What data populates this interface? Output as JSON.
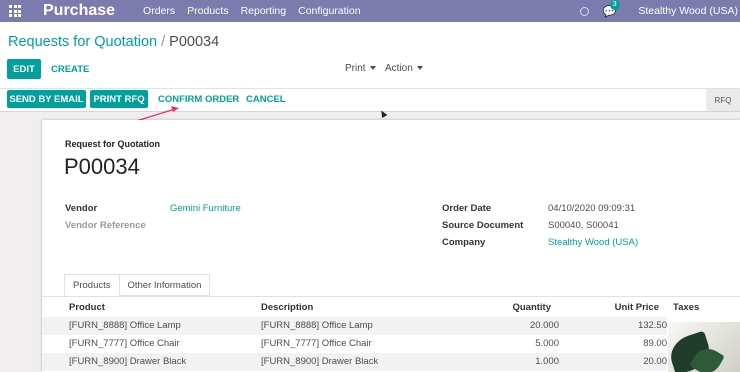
{
  "app": {
    "name": "Purchase"
  },
  "nav": {
    "menu": [
      "Orders",
      "Products",
      "Reporting",
      "Configuration"
    ],
    "chat_badge": "3",
    "company": "Stealthy Wood (USA)"
  },
  "breadcrumb": {
    "parent": "Requests for Quotation",
    "separator": "/",
    "current": "P00034"
  },
  "buttons": {
    "edit": "EDIT",
    "create": "CREATE",
    "print": "Print",
    "action": "Action",
    "send_email": "SEND BY EMAIL",
    "print_rfq": "PRINT RFQ",
    "confirm": "CONFIRM ORDER",
    "cancel": "CANCEL"
  },
  "status": {
    "stage": "RFQ"
  },
  "form": {
    "subtitle": "Request for Quotation",
    "name": "P00034",
    "vendor_label": "Vendor",
    "vendor_value": "Gemini Furniture",
    "vendor_ref_label": "Vendor Reference",
    "order_date_label": "Order Date",
    "order_date_value": "04/10/2020 09:09:31",
    "source_doc_label": "Source Document",
    "source_doc_value": "S00040, S00041",
    "company_label": "Company",
    "company_value": "Stealthy Wood (USA)"
  },
  "tabs": [
    "Products",
    "Other Information"
  ],
  "table": {
    "headers": {
      "product": "Product",
      "description": "Description",
      "quantity": "Quantity",
      "unit_price": "Unit Price",
      "taxes": "Taxes"
    },
    "rows": [
      {
        "product": "[FURN_8888] Office Lamp",
        "description": "[FURN_8888] Office Lamp",
        "quantity": "20.000",
        "unit_price": "132.50"
      },
      {
        "product": "[FURN_7777] Office Chair",
        "description": "[FURN_7777] Office Chair",
        "quantity": "5.000",
        "unit_price": "89.00"
      },
      {
        "product": "[FURN_8900] Drawer Black",
        "description": "[FURN_8900] Drawer Black",
        "quantity": "1.000",
        "unit_price": "20.00"
      }
    ]
  },
  "colors": {
    "navbar": "#7c7bad",
    "accent": "#00a09d",
    "annotation_arrow": "#e8336b"
  }
}
